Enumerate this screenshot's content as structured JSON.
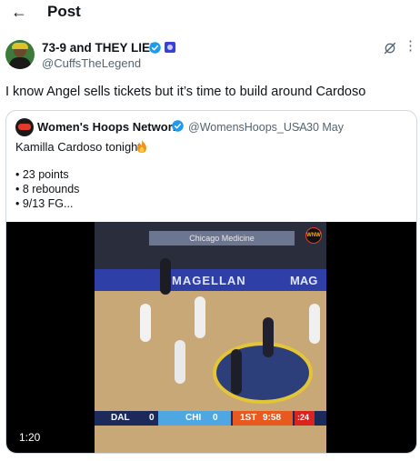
{
  "header": {
    "title": "Post",
    "back_icon": "arrow-left-icon"
  },
  "post": {
    "author": {
      "name": "73-9 and THEY LIED",
      "handle": "@CuffsTheLegend",
      "verified_color": "#1d9bf0",
      "affiliate_color": "#3a3fd6"
    },
    "text": "I know Angel sells tickets but it’s time to build around Cardoso"
  },
  "quote": {
    "author": {
      "name": "Women's Hoops Network",
      "handle": "@WomensHoops_USA",
      "separator": "·",
      "date": "30 May"
    },
    "text": "Kamilla Cardoso tonight",
    "bullets": [
      "• 23 points",
      "• 8 rebounds",
      "• 9/13 FG..."
    ],
    "video": {
      "duration": "1:20",
      "arena_board": "Chicago Medicine",
      "ad_main": "MAGELLAN",
      "ad_partial": "MAG",
      "logo_text": "WNW",
      "scoreboard": {
        "team1": "DAL",
        "score1": "0",
        "team2": "CHI",
        "score2": "0",
        "period": "1ST",
        "clock": "9:58",
        "shot_clock": ":24"
      }
    }
  },
  "colors": {
    "accent": "#1d9bf0",
    "text_secondary": "#536471",
    "border": "#cfd9de"
  }
}
